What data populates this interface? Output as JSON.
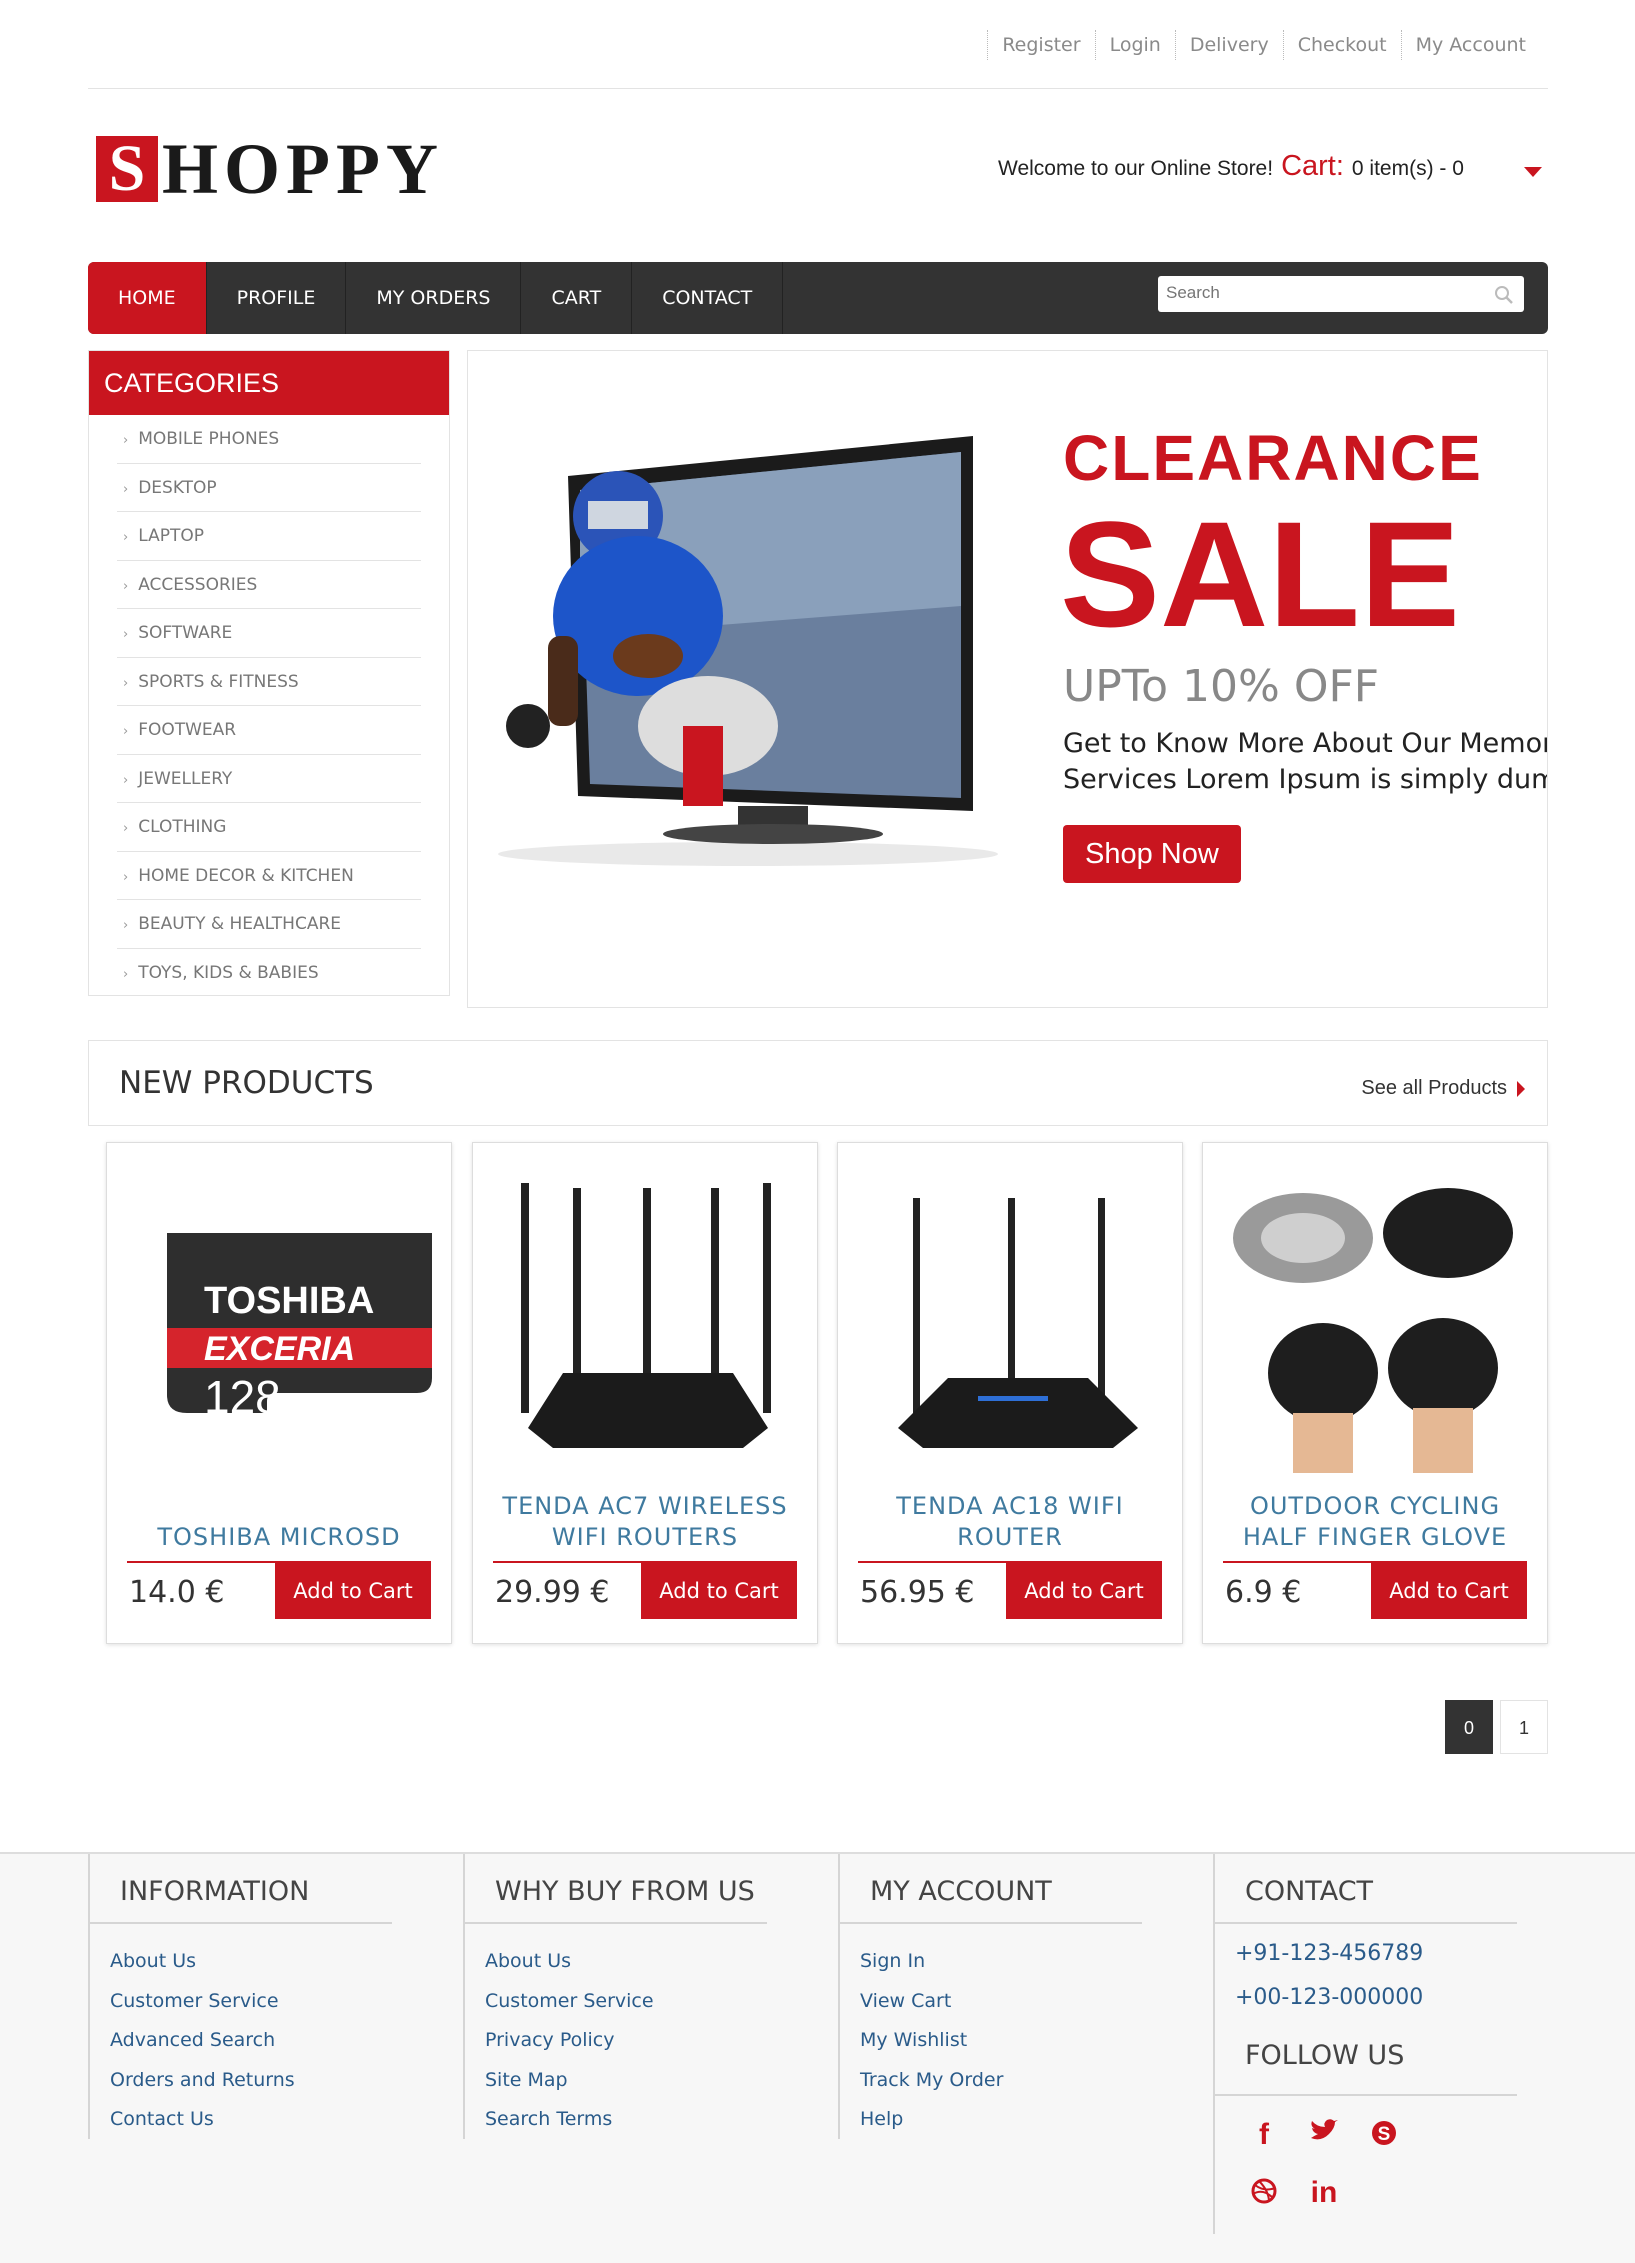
{
  "toplinks": [
    "Register",
    "Login",
    "Delivery",
    "Checkout",
    "My Account"
  ],
  "logo": {
    "first": "S",
    "rest": "HOPPY"
  },
  "header": {
    "welcome": "Welcome to our Online Store!",
    "cart_label": "Cart:",
    "cart_items": "0 item(s) - 0"
  },
  "nav": {
    "items": [
      "HOME",
      "PROFILE",
      "MY ORDERS",
      "CART",
      "CONTACT"
    ],
    "search_placeholder": "Search"
  },
  "categories": {
    "title": "CATEGORIES",
    "items": [
      "MOBILE PHONES",
      "DESKTOP",
      "LAPTOP",
      "ACCESSORIES",
      "SOFTWARE",
      "SPORTS & FITNESS",
      "FOOTWEAR",
      "JEWELLERY",
      "CLOTHING",
      "HOME DECOR & KITCHEN",
      "BEAUTY & HEALTHCARE",
      "TOYS, KIDS & BABIES"
    ]
  },
  "banner": {
    "line1": "CLEARANCE",
    "line2": "SALE",
    "line3": "UPTo 10% OFF",
    "desc1": "Get to Know More About Our Memora",
    "desc2": "Services Lorem Ipsum is simply dumi",
    "button": "Shop Now"
  },
  "new_products": {
    "title": "NEW PRODUCTS",
    "see_all": "See all Products",
    "add_label": "Add to Cart",
    "items": [
      {
        "name": "TOSHIBA MICROSD",
        "price": "14.0 €"
      },
      {
        "name": "TENDA AC7 WIRELESS WIFI ROUTERS",
        "price": "29.99 €"
      },
      {
        "name": "TENDA AC18 WIFI ROUTER",
        "price": "56.95 €"
      },
      {
        "name": "OUTDOOR CYCLING HALF FINGER GLOVE",
        "price": "6.9 €"
      }
    ]
  },
  "pagination": [
    "0",
    "1"
  ],
  "footer": {
    "information": {
      "title": "INFORMATION",
      "links": [
        "About Us",
        "Customer Service",
        "Advanced Search",
        "Orders and Returns",
        "Contact Us"
      ]
    },
    "why_buy": {
      "title": "WHY BUY FROM US",
      "links": [
        "About Us",
        "Customer Service",
        "Privacy Policy",
        "Site Map",
        "Search Terms"
      ]
    },
    "my_account": {
      "title": "MY ACCOUNT",
      "links": [
        "Sign In",
        "View Cart",
        "My Wishlist",
        "Track My Order",
        "Help"
      ]
    },
    "contact": {
      "title": "CONTACT",
      "phones": [
        "+91-123-456789",
        "+00-123-000000"
      ],
      "follow_title": "FOLLOW US"
    },
    "social": [
      "facebook-icon",
      "twitter-icon",
      "skype-icon",
      "dribbble-icon",
      "linkedin-icon"
    ]
  },
  "colors": {
    "brand": "#c9151f",
    "nav": "#333333",
    "link": "#2a5b8a"
  }
}
